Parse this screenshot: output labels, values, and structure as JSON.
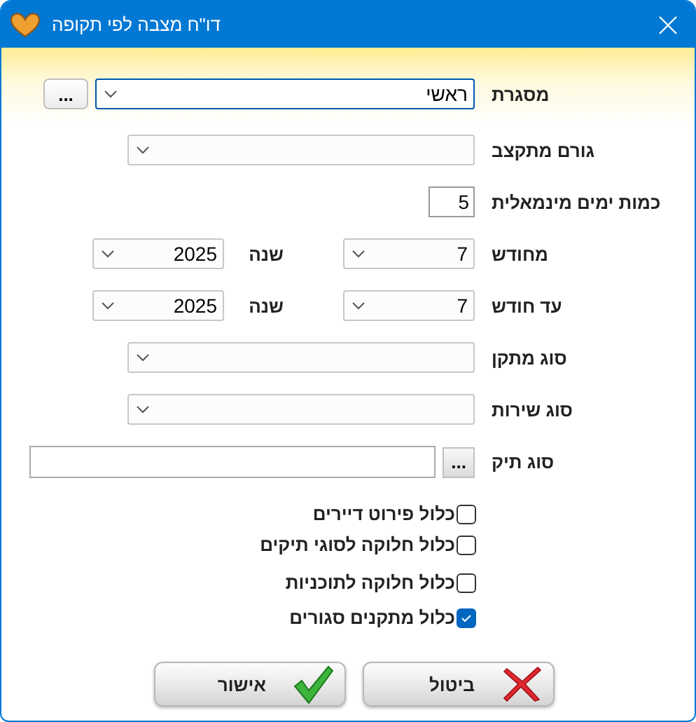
{
  "window": {
    "title": "דו\"ח מצבה לפי תקופה"
  },
  "fields": [
    {
      "kind": "combo_browse",
      "label": "מסגרת",
      "value": "ראשי",
      "button": "...",
      "focused": true
    },
    {
      "kind": "combo",
      "label": "גורם מתקצב",
      "focused": false
    },
    {
      "kind": "number",
      "label": "כמות ימים מינמאלית",
      "value": "5",
      "focused": false
    },
    {
      "kind": "month_year",
      "label": "מחודש",
      "month": "7",
      "year_label": "שנה",
      "year": "2025",
      "focused": false
    },
    {
      "kind": "month_year",
      "label": "עד חודש",
      "month": "7",
      "year_label": "שנה",
      "year": "2025",
      "focused": false
    },
    {
      "kind": "combo",
      "label": "סוג מתקן",
      "focused": false
    },
    {
      "kind": "combo",
      "label": "סוג שירות",
      "focused": false
    },
    {
      "kind": "text_browse",
      "label": "סוג תיק",
      "button": "...",
      "focused": false
    }
  ],
  "checkboxes": [
    {
      "label": "כלול פירוט דיירים",
      "checked": false
    },
    {
      "label": "כלול חלוקה לסוגי תיקים",
      "checked": false
    },
    {
      "label": "כלול חלוקה לתוכניות",
      "checked": false
    },
    {
      "label": "כלול מתקנים סגורים",
      "checked": true
    }
  ],
  "buttons": [
    {
      "kind": "cancel",
      "label": "ביטול"
    },
    {
      "kind": "ok",
      "label": "אישור"
    }
  ]
}
